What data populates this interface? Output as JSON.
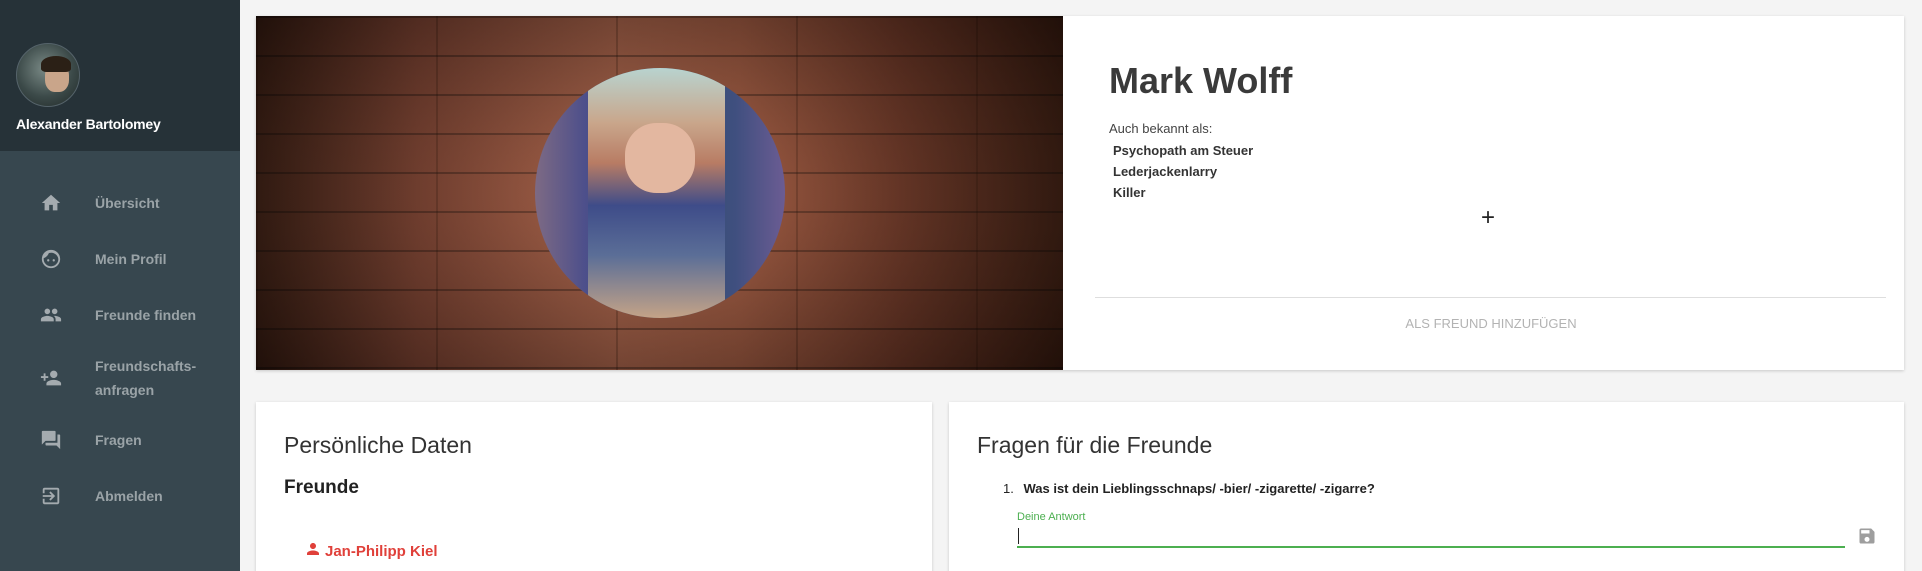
{
  "user": {
    "name": "Alexander Bartolomey"
  },
  "nav": [
    {
      "label": "Übersicht",
      "icon": "home-icon"
    },
    {
      "label": "Mein Profil",
      "icon": "face-icon"
    },
    {
      "label": "Freunde finden",
      "icon": "people-icon"
    },
    {
      "label": "Freundschafts-\nanfragen",
      "icon": "person-add-icon"
    },
    {
      "label": "Fragen",
      "icon": "forum-icon"
    },
    {
      "label": "Abmelden",
      "icon": "exit-icon"
    }
  ],
  "profile": {
    "name": "Mark Wolff",
    "aka_label": "Auch bekannt als:",
    "aliases": [
      "Psychopath am Steuer",
      "Lederjackenlarry",
      "Killer"
    ],
    "add_alias_symbol": "+",
    "add_friend_label": "ALS FREUND HINZUFÜGEN"
  },
  "personal": {
    "title": "Persönliche Daten",
    "friends_heading": "Freunde",
    "friends": [
      "Jan-Philipp Kiel"
    ]
  },
  "questions": {
    "title": "Fragen für die Freunde",
    "items": [
      {
        "number": "1.",
        "text": "Was ist dein Lieblingsschnaps/ -bier/ -zigarette/ -zigarre?"
      }
    ],
    "answer_label": "Deine Antwort",
    "answer_value": ""
  },
  "colors": {
    "sidebar_bg": "#37474f",
    "sidebar_head_bg": "#263238",
    "accent_green": "#4caf50",
    "friend_link_red": "#e0403a"
  }
}
